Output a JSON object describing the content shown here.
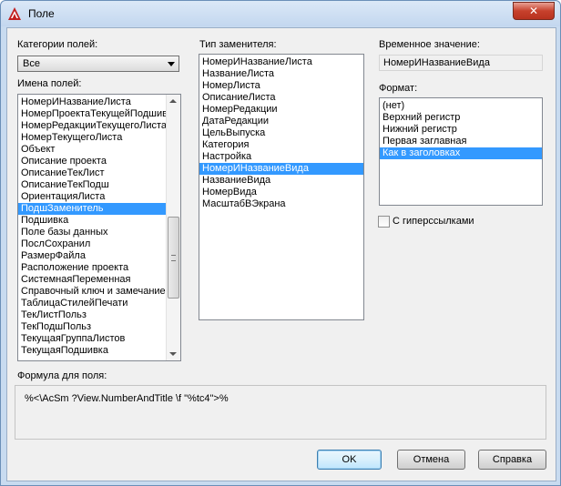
{
  "window": {
    "title": "Поле",
    "close_label": "✕"
  },
  "categories": {
    "label": "Категории полей:",
    "selected": "Все"
  },
  "field_names": {
    "label": "Имена полей:",
    "items": [
      "НомерИНазваниеЛиста",
      "НомерПроектаТекущейПодшивки",
      "НомерРедакцииТекущегоЛиста",
      "НомерТекущегоЛиста",
      "Объект",
      "Описание проекта",
      "ОписаниеТекЛист",
      "ОписаниеТекПодш",
      "ОриентацияЛиста",
      "ПодшЗаменитель",
      "Подшивка",
      "Поле базы данных",
      "ПослСохранил",
      "РазмерФайла",
      "Расположение проекта",
      "СистемнаяПеременная",
      "Справочный ключ и замечание",
      "ТаблицаСтилейПечати",
      "ТекЛистПольз",
      "ТекПодшПольз",
      "ТекущаяГруппаЛистов",
      "ТекущаяПодшивка"
    ],
    "selected_index": 9
  },
  "replacement_type": {
    "label": "Тип заменителя:",
    "items": [
      "НомерИНазваниеЛиста",
      "НазваниеЛиста",
      "НомерЛиста",
      "ОписаниеЛиста",
      "НомерРедакции",
      "ДатаРедакции",
      "ЦельВыпуска",
      "Категория",
      "Настройка",
      "НомерИНазваниеВида",
      "НазваниеВида",
      "НомерВида",
      "МасштабВЭкрана"
    ],
    "selected_index": 9
  },
  "temp_value": {
    "label": "Временное значение:",
    "value": "НомерИНазваниеВида"
  },
  "format": {
    "label": "Формат:",
    "items": [
      "(нет)",
      "Верхний регистр",
      "Нижний регистр",
      "Первая заглавная",
      "Как в заголовках"
    ],
    "selected_index": 4
  },
  "hyperlinks": {
    "label": "С гиперссылками",
    "checked": false
  },
  "formula": {
    "label": "Формула для поля:",
    "value": "%<\\AcSm ?View.NumberAndTitle \\f \"%tc4\">%"
  },
  "buttons": {
    "ok": "OK",
    "cancel": "Отмена",
    "help": "Справка"
  },
  "colors": {
    "selection": "#3399ff",
    "close_button": "#c7412c",
    "title_gradient": "#c3d7ef"
  }
}
